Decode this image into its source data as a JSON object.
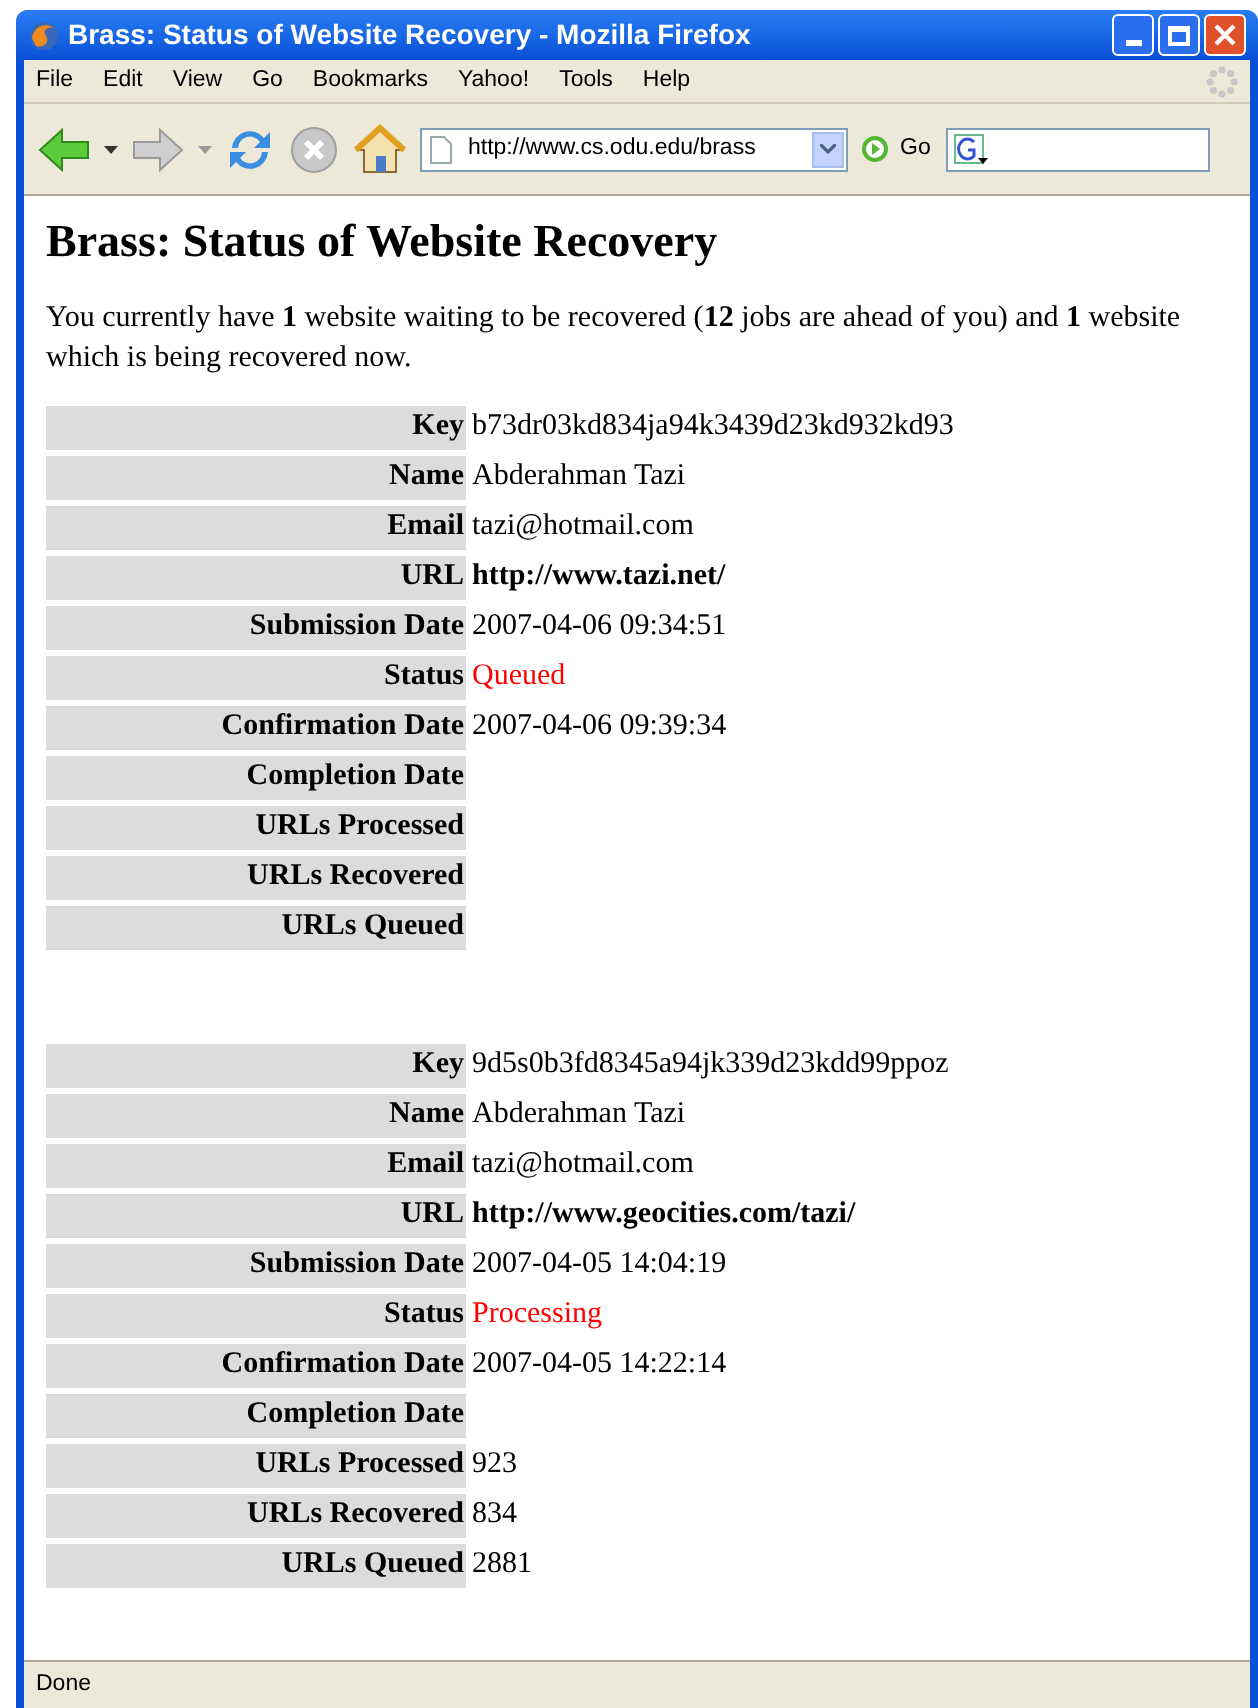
{
  "window": {
    "title": "Brass: Status of Website Recovery - Mozilla Firefox"
  },
  "menu": [
    "File",
    "Edit",
    "View",
    "Go",
    "Bookmarks",
    "Yahoo!",
    "Tools",
    "Help"
  ],
  "toolbar": {
    "address": "http://www.cs.odu.edu/brass",
    "go": "Go"
  },
  "page": {
    "heading": "Brass: Status of Website Recovery",
    "summary": "You currently have **1** website waiting to be recovered (**12** jobs are ahead of you) and **1** website which is being recovered now.",
    "records": [
      {
        "fields": [
          {
            "label": "Key",
            "value": "b73dr03kd834ja94k3439d23kd932kd93",
            "kind": "plain"
          },
          {
            "label": "Name",
            "value": "Abderahman Tazi",
            "kind": "plain"
          },
          {
            "label": "Email",
            "value": "tazi@hotmail.com",
            "kind": "plain"
          },
          {
            "label": "URL",
            "value": "http://www.tazi.net/",
            "kind": "url"
          },
          {
            "label": "Submission Date",
            "value": "2007-04-06 09:34:51",
            "kind": "plain"
          },
          {
            "label": "Status",
            "value": "Queued",
            "kind": "status"
          },
          {
            "label": "Confirmation Date",
            "value": "2007-04-06 09:39:34",
            "kind": "plain"
          },
          {
            "label": "Completion Date",
            "kind": "plain"
          },
          {
            "label": "URLs Processed",
            "kind": "plain"
          },
          {
            "label": "URLs Recovered",
            "kind": "plain"
          },
          {
            "label": "URLs Queued",
            "kind": "plain"
          }
        ]
      },
      {
        "fields": [
          {
            "label": "Key",
            "value": "9d5s0b3fd8345a94jk339d23kdd99ppoz",
            "kind": "plain"
          },
          {
            "label": "Name",
            "value": "Abderahman Tazi",
            "kind": "plain"
          },
          {
            "label": "Email",
            "value": "tazi@hotmail.com",
            "kind": "plain"
          },
          {
            "label": "URL",
            "value": "http://www.geocities.com/tazi/",
            "kind": "url"
          },
          {
            "label": "Submission Date",
            "value": "2007-04-05 14:04:19",
            "kind": "plain"
          },
          {
            "label": "Status",
            "value": "Processing",
            "kind": "status"
          },
          {
            "label": "Confirmation Date",
            "value": "2007-04-05 14:22:14",
            "kind": "plain"
          },
          {
            "label": "Completion Date",
            "kind": "plain"
          },
          {
            "label": "URLs Processed",
            "value": "923",
            "kind": "plain"
          },
          {
            "label": "URLs Recovered",
            "value": "834",
            "kind": "plain"
          },
          {
            "label": "URLs Queued",
            "value": "2881",
            "kind": "plain"
          }
        ]
      }
    ]
  },
  "status_bar": "Done"
}
